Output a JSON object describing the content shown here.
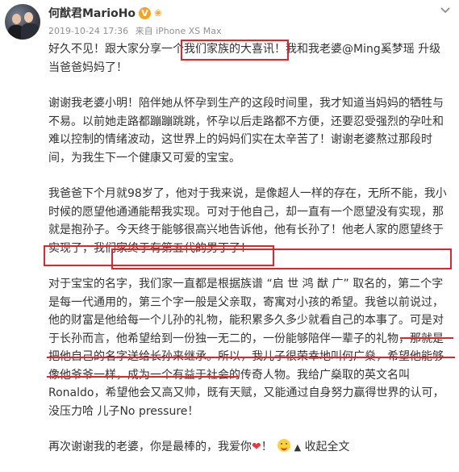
{
  "post": {
    "author": "何猷君MarioHo",
    "timestamp": "2019-10-24 17:36",
    "source": "来自 iPhone XS Max",
    "paragraphs": [
      [
        "好久不见！跟大家分享一个",
        "我们家族的大喜讯！",
        "我和我老婆@Ming奚梦瑶 升级当爸爸妈妈了！"
      ],
      [
        "谢谢我老婆小明！陪伴她从怀孕到生产的这段时间里，我才知道当妈妈的牺牲与不易。以前她走路都蹦蹦跳跳，怀孕以后走路都不方便，还要忍受强烈的孕吐和难以控制的情绪波动，这世界上的妈妈们实在太辛苦了！谢谢老婆熬过那段时间，为我生下一个健康又可爱的宝宝。"
      ],
      [
        "我爸爸下个月就98岁了，他对于我来说，是像超人一样的存在，无所不能，我小时候的愿望他通通能帮我实现。可对于他自己，却一直有一个愿望没有实现，那就是抱孙子。",
        "今天终于能够很高兴地告诉他，他有长孙了！他老人家的愿望终于实现了，我们家终于有第五代的男丁了！"
      ],
      [
        "对于宝宝的名字，我们家一直都是根据族谱 “启 世 鸿 猷 广” 取名的，第二个字是每一代通用的，第三个字一般是父亲取，寄寓对小孩的希望。我爸以前说过，他的财富是他给每一个儿孙的礼物，能积累多久多少就看自己的本事了。",
        "可是对于长孙而言，他希望给到一份独一无二的，一份能够陪伴一辈子的礼物，那就是把他自己的名字送给长孙来继承。",
        "所以，我儿子很荣幸地叫何广燊，希望他能够像他爷爷一样，成为一个有益于社会的传奇人物。我给广燊取的英文名叫Ronaldo，希望他会又高又帅，既有天赋，又能通过自身努力赢得世界的认可，没压力哈 儿子No pressure！"
      ]
    ],
    "closing": "再次谢谢我的老婆，你是最棒的，我爱你",
    "favorite_label": "收起全文"
  },
  "colors": {
    "highlight_box": "#e0262b",
    "verify_badge": "#f8a21e",
    "heart": "#e4393c"
  },
  "icons": [
    "verified-badge-icon",
    "chevron-down-icon",
    "heart-icon",
    "emoji-icon",
    "collapse-arrow-icon"
  ]
}
